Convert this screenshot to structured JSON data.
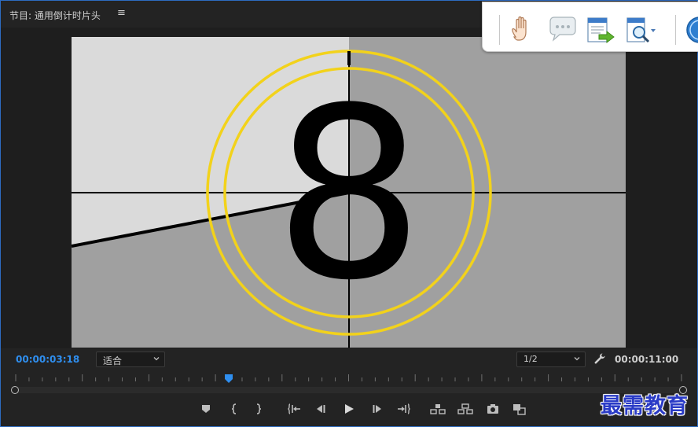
{
  "panel": {
    "title": "节目: 通用倒计时片头",
    "menu_icon": "hamburger-icon"
  },
  "viewer": {
    "countdown_number": "8"
  },
  "status": {
    "current_timecode": "00:00:03:18",
    "fit_label": "适合",
    "resolution_label": "1/2",
    "duration_timecode": "00:00:11:00",
    "settings_icon": "wrench-icon",
    "playhead_position": 0.32
  },
  "controls": [
    {
      "name": "add-marker-button",
      "icon": "marker-icon"
    },
    {
      "name": "mark-in-button",
      "icon": "mark-in-icon"
    },
    {
      "name": "mark-out-button",
      "icon": "mark-out-icon"
    },
    {
      "name": "go-to-in-button",
      "icon": "go-to-in-icon"
    },
    {
      "name": "step-back-button",
      "icon": "step-back-icon"
    },
    {
      "name": "play-button",
      "icon": "play-icon"
    },
    {
      "name": "step-forward-button",
      "icon": "step-forward-icon"
    },
    {
      "name": "go-to-out-button",
      "icon": "go-to-out-icon"
    },
    {
      "name": "lift-button",
      "icon": "lift-icon"
    },
    {
      "name": "extract-button",
      "icon": "extract-icon"
    },
    {
      "name": "export-frame-button",
      "icon": "camera-icon"
    },
    {
      "name": "compare-view-button",
      "icon": "compare-icon"
    }
  ],
  "overlay_toolbar": [
    {
      "name": "hand-tool-button",
      "icon": "hand-icon"
    },
    {
      "name": "comment-button",
      "icon": "speech-bubble-icon"
    },
    {
      "name": "export-document-button",
      "icon": "document-arrow-icon"
    },
    {
      "name": "zoom-document-button",
      "icon": "magnifier-icon"
    },
    {
      "name": "help-button",
      "icon": "help-circle-icon"
    }
  ],
  "watermark": "最需教育",
  "colors": {
    "accent_blue": "#2f8ff0",
    "panel_border": "#2d6bc0",
    "leader_ring": "#f2d21b",
    "frame_light": "#dadada",
    "frame_mid": "#a0a0a0"
  }
}
